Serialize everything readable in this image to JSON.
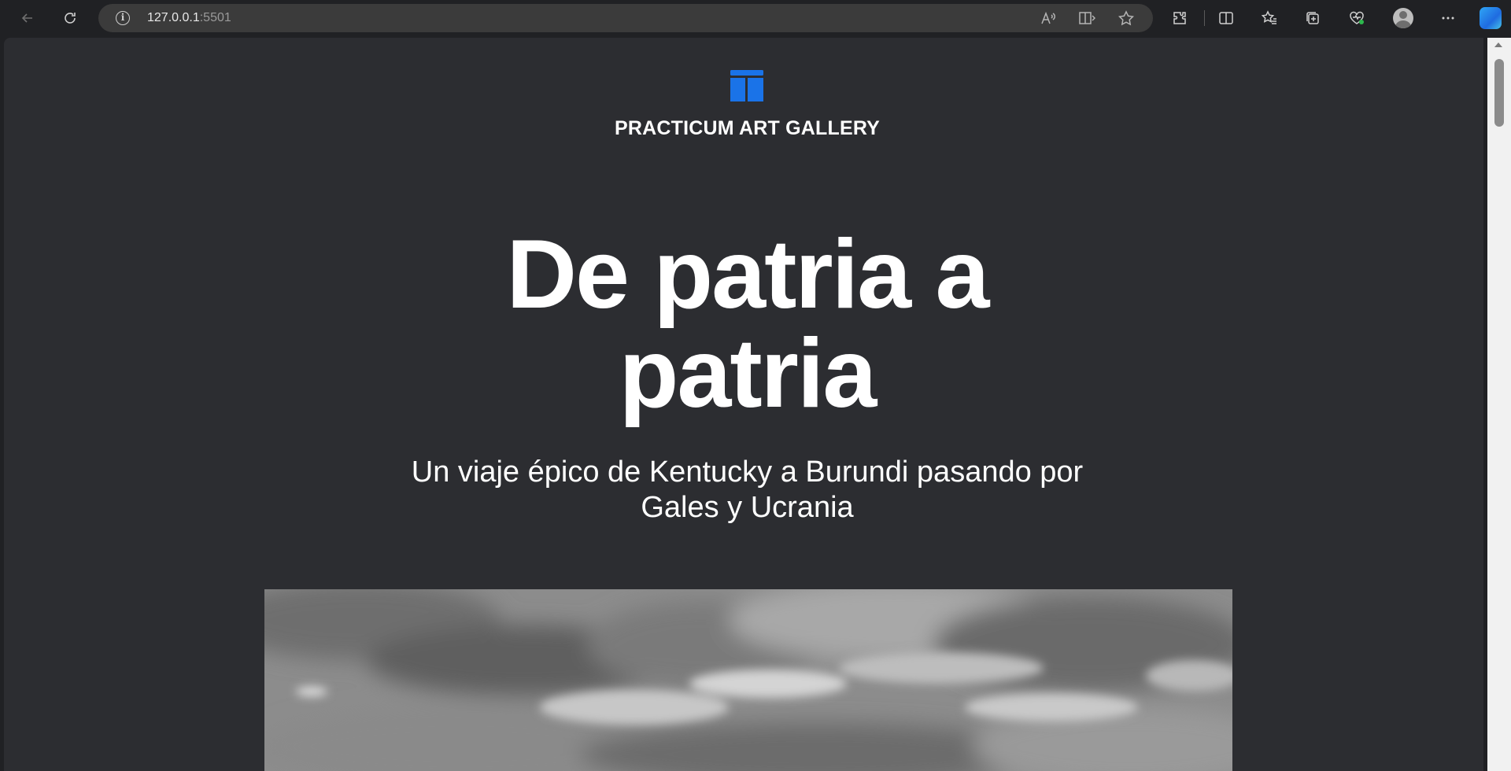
{
  "browser": {
    "url_host": "127.0.0.1",
    "url_port": ":5501",
    "icons": [
      "back-icon",
      "refresh-icon",
      "site-info-icon",
      "read-aloud-icon",
      "immersive-reader-icon",
      "favorite-star-icon",
      "extensions-icon",
      "split-screen-icon",
      "favorites-icon",
      "collections-icon",
      "browser-essentials-icon",
      "profile-avatar",
      "more-icon",
      "copilot-icon"
    ]
  },
  "page": {
    "brand": "PRACTICUM ART GALLERY",
    "title_line1": "De patria a",
    "title_line2": "patria",
    "subtitle_line1": "Un viaje épico de Kentucky a Burundi pasando por",
    "subtitle_line2": "Gales y Ucrania",
    "hero_image": "grayscale cloudy sky photograph"
  },
  "colors": {
    "page_background": "#2c2d31",
    "chrome_background": "#202124",
    "logo_blue": "#1a73e8",
    "text": "#ffffff"
  }
}
